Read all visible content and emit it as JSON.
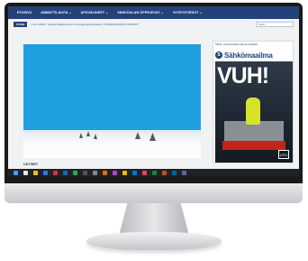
{
  "nav": {
    "items": [
      {
        "label": "ETUSIVU"
      },
      {
        "label": "AMMATTILAISTA ⌄"
      },
      {
        "label": "APUVÄLINEET ⌄"
      },
      {
        "label": "SÄHKÖALAN OPPIKIRJAT ⌄"
      },
      {
        "label": "YHTEYSTIEDOT ⌄"
      }
    ]
  },
  "ticker": {
    "badge": "UUSIN",
    "text": "1.10.4.2020 / Uuvelta sähkövoima voi tehtyjä perustehtäviä • AJANKOHTAISTA OPINNOT"
  },
  "search": {
    "placeholder": "Haku..."
  },
  "hero": {
    "caption": "UUTISET"
  },
  "ad": {
    "top_text": "Sähkö- ja tietotekniikan alan ammattilehti",
    "brand": "Sähkömaailma",
    "logo_letter": "S",
    "headline": "VUH!",
    "foot": "UTU"
  },
  "colors": {
    "nav_bg": "#24427a",
    "hero_blue": "#1ea0e0"
  },
  "taskbar": {
    "icons": [
      "windows-icon",
      "search-icon",
      "files-icon",
      "mail-icon",
      "photos-icon",
      "explorer-icon",
      "chrome-icon",
      "terminal-icon",
      "settings-icon",
      "store-icon",
      "media-icon",
      "notes-icon",
      "calendar-icon",
      "music-icon",
      "maps-icon",
      "photos2-icon",
      "outlook-icon",
      "teams-icon"
    ]
  }
}
